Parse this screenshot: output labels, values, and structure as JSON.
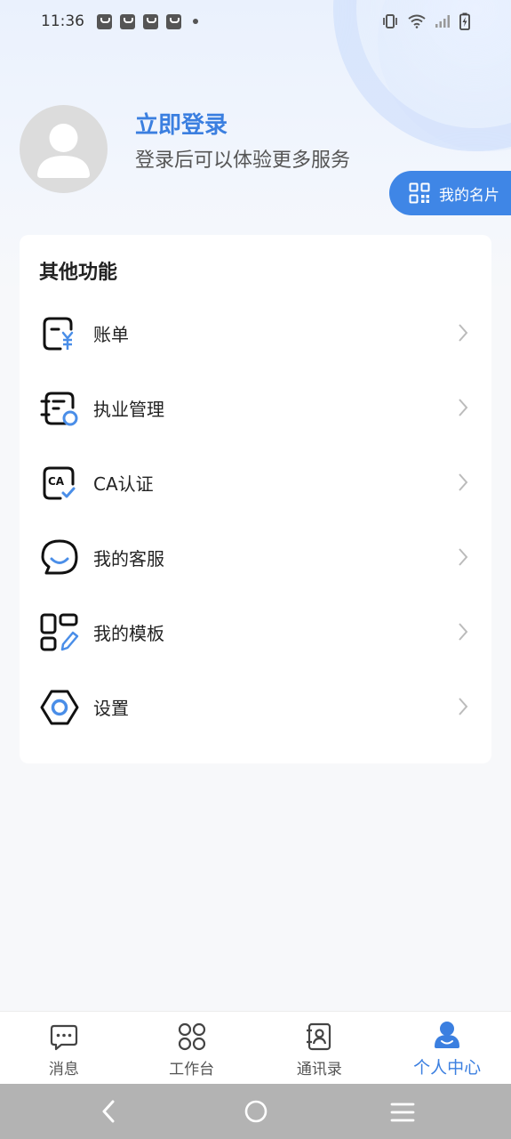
{
  "status_bar": {
    "time": "11:36"
  },
  "profile": {
    "login_title": "立即登录",
    "login_subtitle": "登录后可以体验更多服务",
    "card_button_label": "我的名片"
  },
  "menu": {
    "title": "其他功能",
    "items": [
      {
        "label": "账单",
        "icon": "bill-icon"
      },
      {
        "label": "执业管理",
        "icon": "practice-management-icon"
      },
      {
        "label": "CA认证",
        "icon": "ca-certificate-icon"
      },
      {
        "label": "我的客服",
        "icon": "customer-service-icon"
      },
      {
        "label": "我的模板",
        "icon": "template-icon"
      },
      {
        "label": "设置",
        "icon": "settings-icon"
      }
    ]
  },
  "bottom_nav": {
    "items": [
      {
        "label": "消息",
        "icon": "message-icon",
        "active": false
      },
      {
        "label": "工作台",
        "icon": "workbench-icon",
        "active": false
      },
      {
        "label": "通讯录",
        "icon": "contacts-icon",
        "active": false
      },
      {
        "label": "个人中心",
        "icon": "profile-icon",
        "active": true
      }
    ]
  },
  "colors": {
    "accent": "#3b7fe0",
    "button": "#3f86e6",
    "text": "#222222",
    "avatar_bg": "#dcdcdc"
  }
}
